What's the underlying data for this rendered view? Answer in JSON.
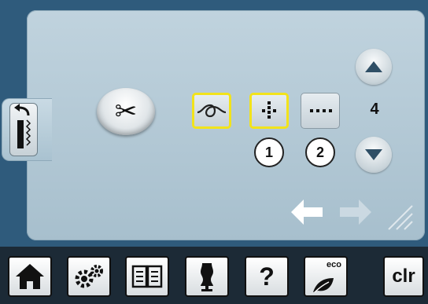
{
  "colors": {
    "screen_bg": "#2f5b7c",
    "panel_bg": "#b4c9d5",
    "selection": "#f2e31b",
    "toolbar_bg": "#1c2a36"
  },
  "icons": {
    "back": "back-arrow-icon",
    "cutter": "scissors-icon",
    "knot": "knot-icon",
    "stitch_dots": "securing-stitch-icon",
    "stitch_row": "stitch-row-icon"
  },
  "main": {
    "cut_symbol": "✂",
    "stitch_count": "4",
    "badge_1": "1",
    "badge_2": "2"
  },
  "toolbar": {
    "home": "home-icon",
    "setup": "setup-gears-icon",
    "tutorial": "book-icon",
    "advisor": "dress-form-icon",
    "help_label": "?",
    "eco_label": "eco",
    "clear_label": "clr"
  }
}
